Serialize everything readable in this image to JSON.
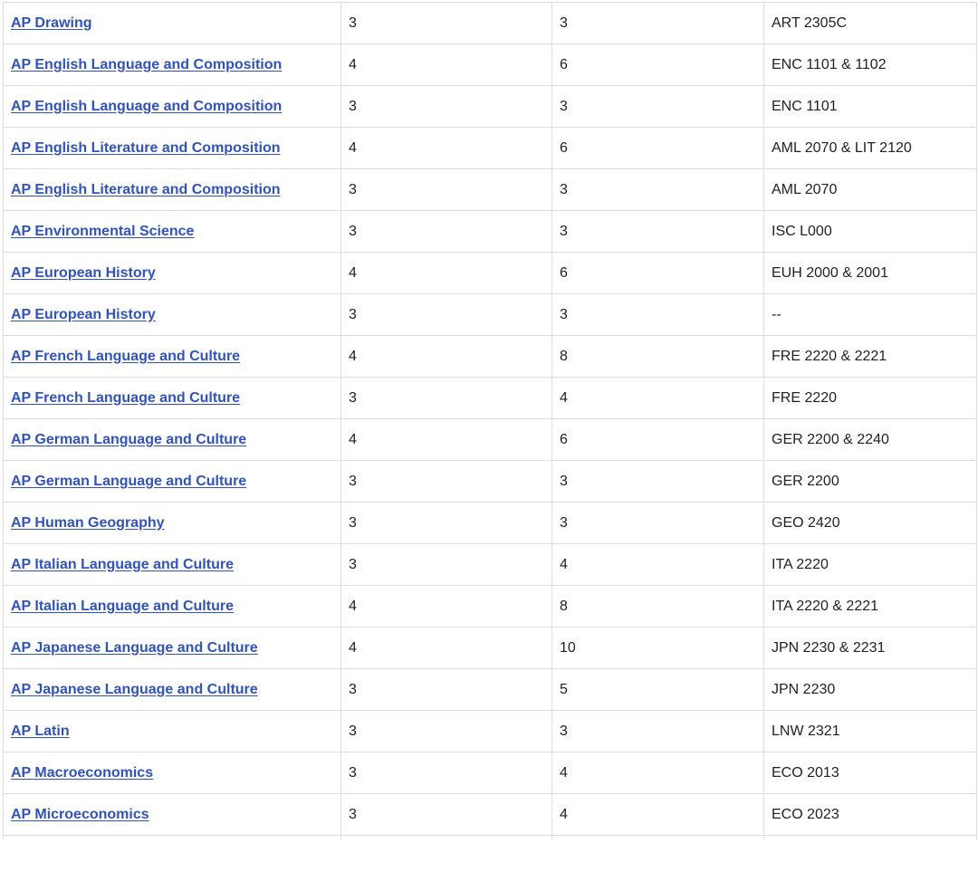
{
  "rows": [
    {
      "course": "AP Drawing",
      "score": "3",
      "credits": "3",
      "equivalent": "ART 2305C"
    },
    {
      "course": "AP English Language and Composition",
      "score": "4",
      "credits": "6",
      "equivalent": "ENC 1101 & 1102"
    },
    {
      "course": "AP English Language and Composition",
      "score": "3",
      "credits": "3",
      "equivalent": "ENC 1101"
    },
    {
      "course": "AP English Literature and Composition",
      "score": "4",
      "credits": "6",
      "equivalent": "AML 2070 & LIT 2120"
    },
    {
      "course": "AP English Literature and Composition",
      "score": "3",
      "credits": "3",
      "equivalent": "AML 2070"
    },
    {
      "course": "AP Environmental Science",
      "score": "3",
      "credits": "3",
      "equivalent": "ISC L000"
    },
    {
      "course": "AP European History",
      "score": "4",
      "credits": "6",
      "equivalent": "EUH 2000 & 2001"
    },
    {
      "course": "AP European History",
      "score": "3",
      "credits": "3",
      "equivalent": "--"
    },
    {
      "course": "AP French Language and Culture",
      "score": "4",
      "credits": "8",
      "equivalent": "FRE 2220 & 2221"
    },
    {
      "course": "AP French Language and Culture",
      "score": "3",
      "credits": "4",
      "equivalent": "FRE 2220"
    },
    {
      "course": "AP German Language and Culture",
      "score": "4",
      "credits": "6",
      "equivalent": "GER 2200 & 2240"
    },
    {
      "course": "AP German Language and Culture",
      "score": "3",
      "credits": "3",
      "equivalent": "GER 2200"
    },
    {
      "course": "AP Human Geography",
      "score": "3",
      "credits": "3",
      "equivalent": "GEO 2420"
    },
    {
      "course": "AP Italian Language and Culture",
      "score": "3",
      "credits": "4",
      "equivalent": "ITA 2220"
    },
    {
      "course": "AP Italian Language and Culture",
      "score": "4",
      "credits": "8",
      "equivalent": "ITA 2220 & 2221"
    },
    {
      "course": "AP Japanese Language and Culture",
      "score": "4",
      "credits": "10",
      "equivalent": "JPN 2230 & 2231"
    },
    {
      "course": "AP Japanese Language and Culture",
      "score": "3",
      "credits": "5",
      "equivalent": "JPN 2230"
    },
    {
      "course": "AP Latin",
      "score": "3",
      "credits": "3",
      "equivalent": "LNW 2321"
    },
    {
      "course": "AP Macroeconomics",
      "score": "3",
      "credits": "4",
      "equivalent": "ECO 2013"
    },
    {
      "course": "AP Microeconomics",
      "score": "3",
      "credits": "4",
      "equivalent": "ECO 2023"
    }
  ]
}
